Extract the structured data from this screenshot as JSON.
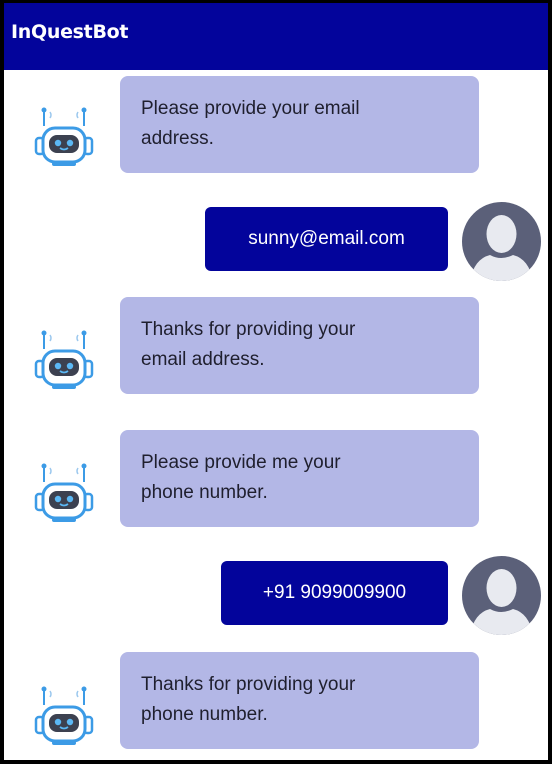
{
  "header": {
    "title": "InQuestBot",
    "background": "#03049b"
  },
  "messages": [
    {
      "sender": "bot",
      "text_lines": [
        "Please provide your email",
        "address."
      ],
      "icon": "robot-icon"
    },
    {
      "sender": "user",
      "text": "sunny@email.com",
      "icon": "user-avatar-icon"
    },
    {
      "sender": "bot",
      "text_lines": [
        "Thanks for providing your",
        "email address."
      ],
      "icon": "robot-icon"
    },
    {
      "sender": "bot",
      "text_lines": [
        "Please provide me your",
        "phone number."
      ],
      "icon": "robot-icon"
    },
    {
      "sender": "user",
      "text": "+91 9099009900",
      "icon": "user-avatar-icon"
    },
    {
      "sender": "bot",
      "text_lines": [
        "Thanks for providing your",
        "phone number."
      ],
      "icon": "robot-icon"
    }
  ],
  "colors": {
    "bot_bubble": "#b3b7e6",
    "user_bubble": "#03049b",
    "avatar_bg": "#5b6079",
    "robot_accent": "#3c9be6"
  }
}
